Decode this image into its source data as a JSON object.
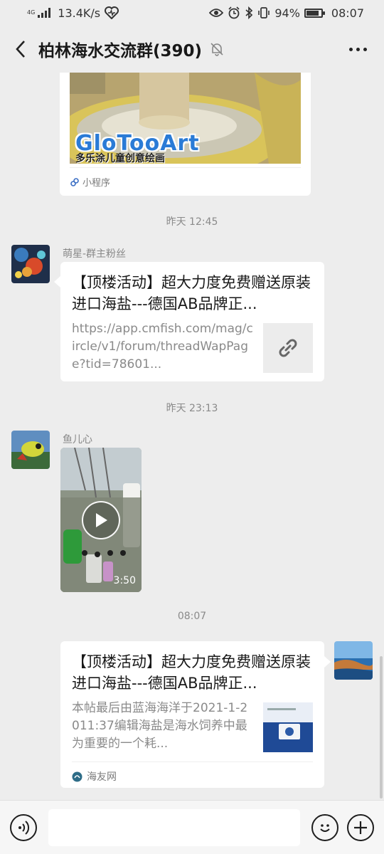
{
  "status": {
    "network_type": "4G",
    "speed": "13.4K/s",
    "battery_percent": "94%",
    "battery_level": 0.94,
    "time": "08:07"
  },
  "header": {
    "title": "柏林海水交流群(390)"
  },
  "messages": {
    "mini_program": {
      "brand": "GloTooArt",
      "brand_sub": "多乐涂儿童创意绘画",
      "source": "小程序"
    },
    "ts1": "昨天 12:45",
    "msg1": {
      "sender": "萌星-群主粉丝",
      "title": "【顶楼活动】超大力度免费赠送原装进口海盐---德国AB品牌正...",
      "desc": "https://app.cmfish.com/mag/circle/v1/forum/threadWapPage?tid=78601..."
    },
    "ts2": "昨天 23:13",
    "msg2": {
      "sender": "鱼儿心",
      "duration": "3:50"
    },
    "ts3": "08:07",
    "msg3": {
      "title": "【顶楼活动】超大力度免费赠送原装进口海盐---德国AB品牌正...",
      "desc": "本帖最后由蓝海海洋于2021-1-2011:37编辑海盐是海水饲养中最为重要的一个耗...",
      "source": "海友网"
    }
  },
  "colors": {
    "background": "#ededed",
    "bubble": "#ffffff",
    "meta_text": "#8a8a8a"
  }
}
